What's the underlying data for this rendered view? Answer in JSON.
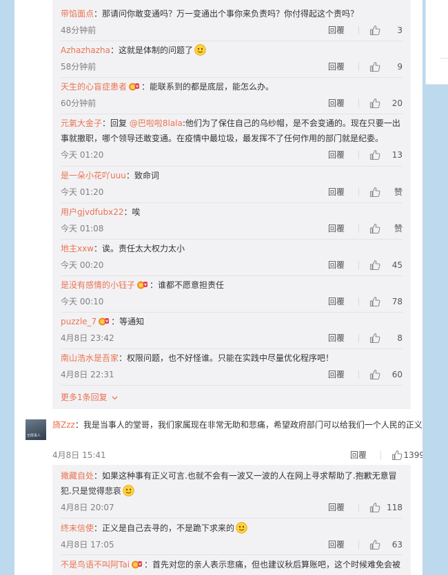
{
  "ui": {
    "reply_label": "回覆",
    "more_replies": "更多1条回复",
    "like_label_empty": "赞"
  },
  "sub_replies_1": [
    {
      "name": "带馅面点",
      "text": "：那请问你敢变通吗？万一变通出个事你来负责吗？你付得起这个责吗？",
      "time": "48分钟前",
      "likes": "3"
    },
    {
      "name": "Azhazhazha",
      "text": "：这就是体制的问题了",
      "time": "58分钟前",
      "likes": "9",
      "emoji": true
    },
    {
      "name": "天生的心盲症患者",
      "text": "：能联系到的都是底层，能怎么办。",
      "time": "60分钟前",
      "likes": "20",
      "badge": true
    },
    {
      "name": "元氣大金子",
      "text_prefix": "：回复 ",
      "mention": "@巴啦啦8lala",
      "text": ":他们为了保住自己的乌纱帽，是不会变通的。现在只要一出事就撤职，哪个领导还敢变通。在疫情中最垃圾，最发挥不了任何作用的部门就是纪委。",
      "time": "今天 01:20",
      "likes": "13"
    },
    {
      "name": "是一朵小花吖uuu",
      "text": "：致命词",
      "time": "今天 01:20",
      "likes": "赞"
    },
    {
      "name": "用户gjvdfubx22",
      "text": "：唉",
      "time": "今天 01:08",
      "likes": "赞"
    },
    {
      "name": "地主xxw",
      "text": "：诶。责任太大权力太小",
      "time": "今天 00:20",
      "likes": "45"
    },
    {
      "name": "是没有感情的小钰子",
      "text": "：谁都不愿意担责任",
      "time": "今天 00:10",
      "likes": "78",
      "badge": true
    },
    {
      "name": "puzzle_7",
      "text": "：等通知",
      "time": "4月8日 23:42",
      "likes": "8",
      "badge": true
    },
    {
      "name": "南山浩水是吾家",
      "text": "：权限问题，也不好怪谁。只能在实践中尽量优化程序吧！",
      "time": "4月8日 22:31",
      "likes": "60"
    }
  ],
  "main_comment": {
    "name": "旖Zzz",
    "text": "：我是当事人的堂哥，我们家属现在非常无助和悲痛，希望政府部门可以给我们一个人民的正义",
    "time": "4月8日 15:41",
    "likes": "1399",
    "avatar_caption": "无限事人"
  },
  "sub_replies_2": [
    {
      "name": "撖藏自处",
      "text": "：如果这种事有正义可言.也就不会有一波又一波的人在网上寻求帮助了.抱歉无意冒犯.只是觉得悲哀",
      "time": "4月8日 20:07",
      "likes": "118",
      "emoji": true
    },
    {
      "name": "终末信使",
      "text": "：正义是自己去寻的，不是跪下求来的",
      "time": "4月8日 17:05",
      "likes": "63",
      "emoji": true
    },
    {
      "name": "不是鸟语不叫阿Tai",
      "text": "：首先对您的亲人表示悲痛，但也建议秋后算账吧，这个时候难免会被",
      "badge": true
    }
  ]
}
